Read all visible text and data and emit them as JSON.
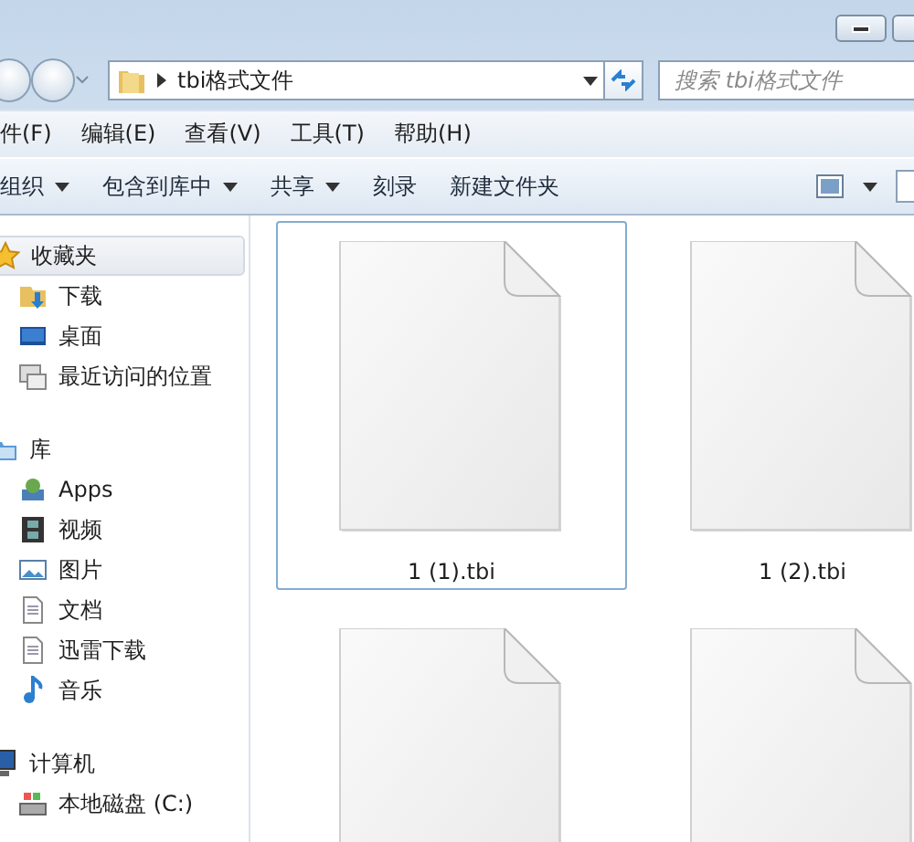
{
  "address_bar": {
    "path": "tbi格式文件",
    "search_placeholder": "搜索 tbi格式文件"
  },
  "menu_bar": [
    "件(F)",
    "编辑(E)",
    "查看(V)",
    "工具(T)",
    "帮助(H)"
  ],
  "toolbar": [
    {
      "label": "组织",
      "dropdown": true
    },
    {
      "label": "包含到库中",
      "dropdown": true
    },
    {
      "label": "共享",
      "dropdown": true
    },
    {
      "label": "刻录",
      "dropdown": false
    },
    {
      "label": "新建文件夹",
      "dropdown": false
    }
  ],
  "sidebar": [
    {
      "label": "收藏夹",
      "kind": "star",
      "selected": true,
      "children": [
        {
          "label": "下载",
          "kind": "download",
          "selected": false
        },
        {
          "label": "桌面",
          "kind": "desktop",
          "selected": false
        },
        {
          "label": "最近访问的位置",
          "kind": "recent",
          "selected": false
        }
      ]
    },
    {
      "label": "库",
      "kind": "library",
      "selected": false,
      "children": [
        {
          "label": "Apps",
          "kind": "apps",
          "selected": false
        },
        {
          "label": "视频",
          "kind": "video",
          "selected": false
        },
        {
          "label": "图片",
          "kind": "pictures",
          "selected": false
        },
        {
          "label": "文档",
          "kind": "document",
          "selected": false
        },
        {
          "label": "迅雷下载",
          "kind": "document",
          "selected": false
        },
        {
          "label": "音乐",
          "kind": "music",
          "selected": false
        }
      ]
    },
    {
      "label": "计算机",
      "kind": "computer",
      "selected": false,
      "children": [
        {
          "label": "本地磁盘 (C:)",
          "kind": "drive",
          "selected": false
        }
      ]
    }
  ],
  "files": [
    {
      "name": "1 (1).tbi",
      "selected": true
    },
    {
      "name": "1 (2).tbi",
      "selected": false
    },
    {
      "selected": false
    },
    {
      "selected": false
    }
  ]
}
